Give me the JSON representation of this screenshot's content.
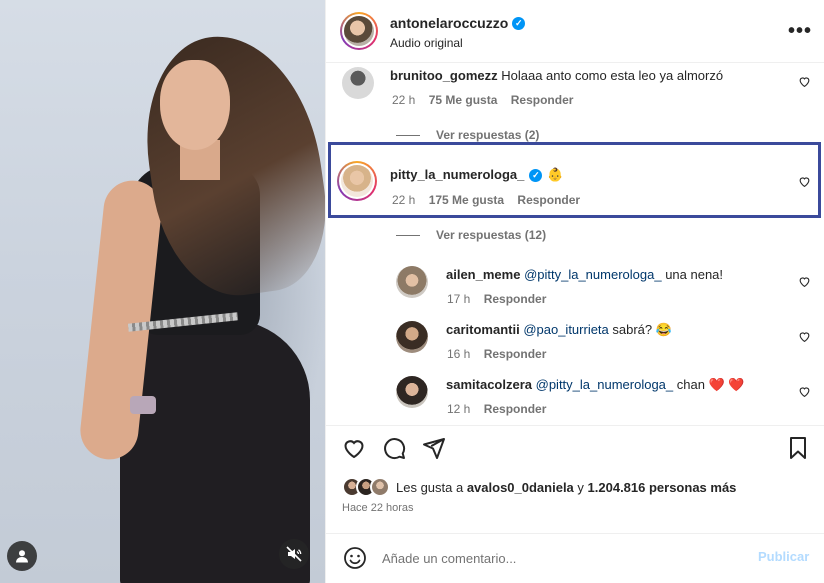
{
  "post": {
    "author": "antonelaroccuzzo",
    "subtitle": "Audio original",
    "more_icon": "more-horizontal-icon"
  },
  "comments": [
    {
      "username": "brunitoo_gomezz",
      "verified": false,
      "text": "Holaaa anto como esta leo ya almorzó",
      "time": "22 h",
      "likes": "75 Me gusta",
      "reply": "Responder",
      "view_replies": "Ver respuestas (2)"
    },
    {
      "username": "pitty_la_numerologa_",
      "verified": true,
      "text": "👶",
      "time": "22 h",
      "likes": "175 Me gusta",
      "reply": "Responder",
      "view_replies": "Ver respuestas (12)"
    }
  ],
  "replies": [
    {
      "username": "ailen_meme",
      "mention": "@pitty_la_numerologa_",
      "text": " una nena!",
      "time": "17 h",
      "reply": "Responder"
    },
    {
      "username": "caritomantii",
      "mention": "@pao_iturrieta",
      "text": " sabrá? 😂",
      "time": "16 h",
      "reply": "Responder"
    },
    {
      "username": "samitacolzera",
      "mention": "@pitty_la_numerologa_",
      "text": " chan ❤️ ❤️",
      "time": "12 h",
      "reply": "Responder"
    }
  ],
  "likes_summary": {
    "prefix": "Les gusta a ",
    "user": "avalos0_0daniela",
    "middle": " y ",
    "count": "1.204.816 personas más"
  },
  "posted_ago": "Hace 22 horas",
  "composer": {
    "placeholder": "Añade un comentario...",
    "publish_label": "Publicar"
  },
  "colors": {
    "highlight_border": "#3b4a9b",
    "verified": "#0095f6",
    "publish_disabled": "#b3dbff"
  }
}
